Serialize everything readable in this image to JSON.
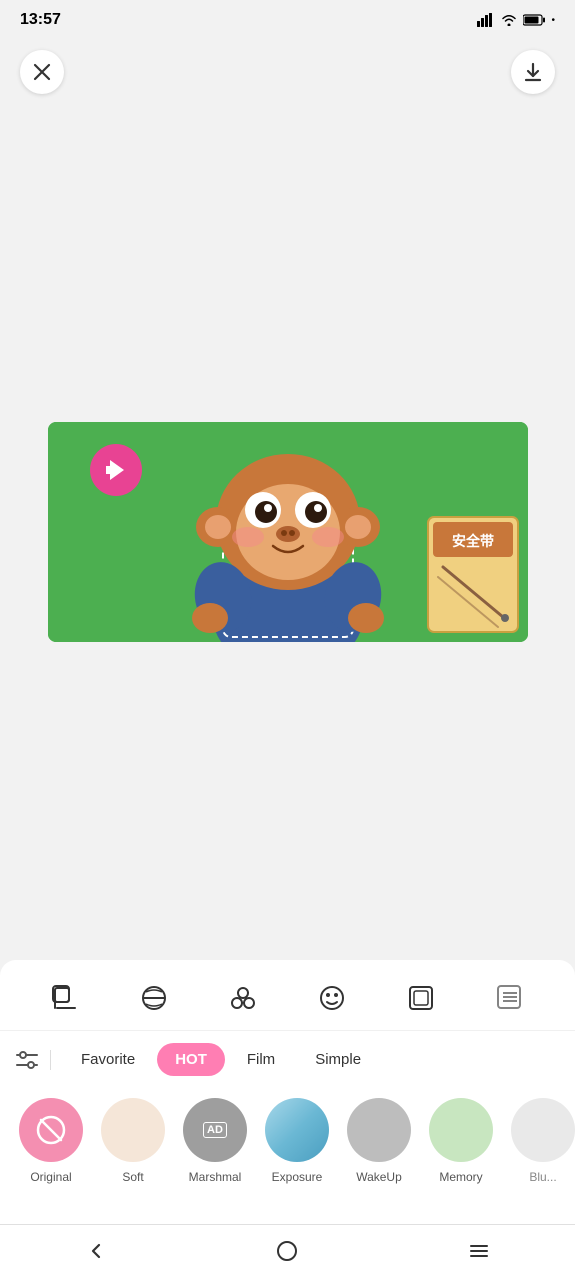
{
  "statusBar": {
    "time": "13:57",
    "icons": [
      "navigation",
      "location",
      "shield",
      "email",
      "mail",
      "dot"
    ]
  },
  "topBar": {
    "closeLabel": "×",
    "downloadLabel": "↓"
  },
  "filterTabs": {
    "settingsIcon": "sliders",
    "tabs": [
      {
        "id": "favorite",
        "label": "Favorite",
        "active": false
      },
      {
        "id": "hot",
        "label": "HOT",
        "active": true
      },
      {
        "id": "film",
        "label": "Film",
        "active": false
      },
      {
        "id": "simple",
        "label": "Simple",
        "active": false
      }
    ]
  },
  "filters": [
    {
      "id": "original",
      "label": "Original",
      "color": "#f48fb1",
      "icon": "ban"
    },
    {
      "id": "soft",
      "label": "Soft",
      "color": "#f5e6d8"
    },
    {
      "id": "marshmal",
      "label": "Marshmal",
      "color": "#9e9e9e",
      "icon": "ad"
    },
    {
      "id": "exposure",
      "label": "Exposure",
      "color": "#7eb8d4"
    },
    {
      "id": "wakeup",
      "label": "WakeUp",
      "color": "#bdbdbd"
    },
    {
      "id": "memory",
      "label": "Memory",
      "color": "#c8e6c0"
    },
    {
      "id": "blur",
      "label": "Blu...",
      "color": "#e0e0e0"
    }
  ],
  "tools": [
    {
      "id": "crop",
      "icon": "crop"
    },
    {
      "id": "filter",
      "icon": "filter"
    },
    {
      "id": "sticker",
      "icon": "sticker"
    },
    {
      "id": "face",
      "icon": "face"
    },
    {
      "id": "frame",
      "icon": "frame"
    },
    {
      "id": "more",
      "icon": "more"
    }
  ],
  "navBar": {
    "back": "‹",
    "home": "○",
    "menu": "≡"
  }
}
